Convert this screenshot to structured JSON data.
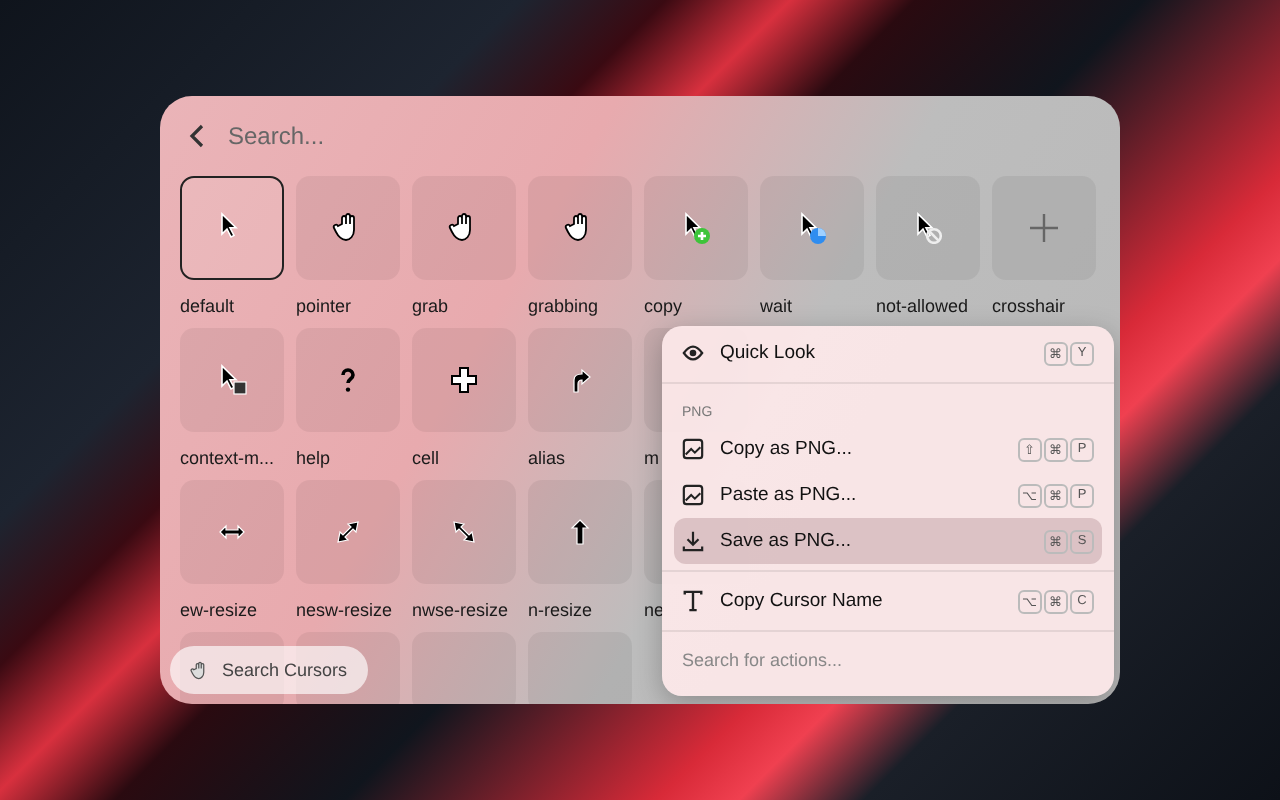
{
  "search": {
    "placeholder": "Search..."
  },
  "cursor_rows": [
    [
      {
        "label": "default",
        "selected": true
      },
      {
        "label": "pointer",
        "selected": false
      },
      {
        "label": "grab",
        "selected": false
      },
      {
        "label": "grabbing",
        "selected": false
      },
      {
        "label": "copy",
        "selected": false
      },
      {
        "label": "wait",
        "selected": false
      },
      {
        "label": "not-allowed",
        "selected": false
      },
      {
        "label": "crosshair",
        "selected": false
      }
    ],
    [
      {
        "label": "context-m...",
        "selected": false
      },
      {
        "label": "help",
        "selected": false
      },
      {
        "label": "cell",
        "selected": false
      },
      {
        "label": "alias",
        "selected": false
      },
      {
        "label": "m",
        "selected": false
      }
    ],
    [
      {
        "label": "ew-resize",
        "selected": false
      },
      {
        "label": "nesw-resize",
        "selected": false
      },
      {
        "label": "nwse-resize",
        "selected": false
      },
      {
        "label": "n-resize",
        "selected": false
      },
      {
        "label": "ne",
        "selected": false
      }
    ]
  ],
  "search_cursors_button": {
    "label": "Search Cursors"
  },
  "action_menu": {
    "items": [
      {
        "kind": "action",
        "label": "Quick Look",
        "keys": [
          "⌘",
          "Y"
        ],
        "selected": false
      },
      {
        "kind": "divider"
      },
      {
        "kind": "section",
        "label": "PNG"
      },
      {
        "kind": "action",
        "label": "Copy as PNG...",
        "keys": [
          "⇧",
          "⌘",
          "P"
        ],
        "selected": false
      },
      {
        "kind": "action",
        "label": "Paste as PNG...",
        "keys": [
          "⌥",
          "⌘",
          "P"
        ],
        "selected": false
      },
      {
        "kind": "action",
        "label": "Save as PNG...",
        "keys": [
          "⌘",
          "S"
        ],
        "selected": true
      },
      {
        "kind": "divider"
      },
      {
        "kind": "action",
        "label": "Copy Cursor Name",
        "keys": [
          "⌥",
          "⌘",
          "C"
        ],
        "selected": false
      }
    ],
    "search": {
      "placeholder": "Search for actions..."
    }
  }
}
